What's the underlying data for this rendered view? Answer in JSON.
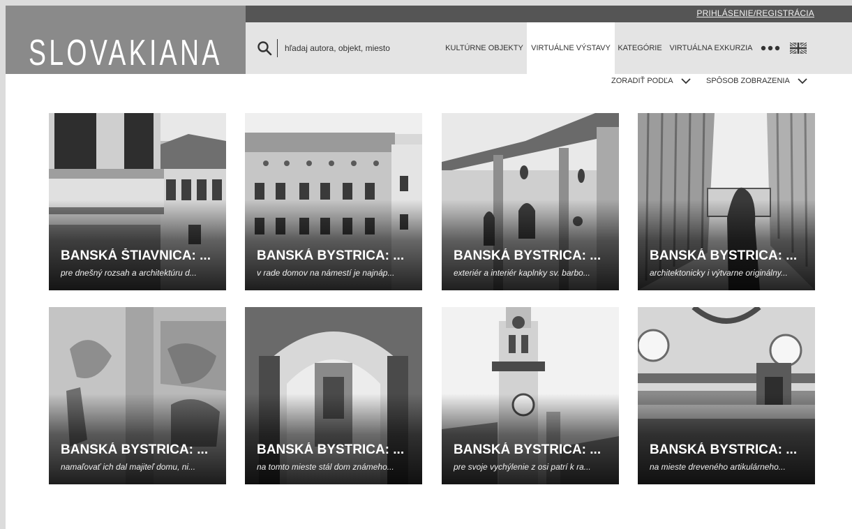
{
  "brand": {
    "logo": "SLOVAKIANA"
  },
  "header": {
    "login_label": "PRIHLÁSENIE/REGISTRÁCIA"
  },
  "search": {
    "placeholder": "hľadaj autora, objekt, miesto"
  },
  "nav": {
    "items": [
      {
        "label": "KULTÚRNE OBJEKTY",
        "active": false
      },
      {
        "label": "VIRTUÁLNE VÝSTAVY",
        "active": true
      },
      {
        "label": "KATEGÓRIE",
        "active": false
      },
      {
        "label": "VIRTUÁLNA EXKURZIA",
        "active": false
      }
    ],
    "more_icon": "ellipsis-icon",
    "language_icon": "uk-flag-icon"
  },
  "toolbar": {
    "sort_label": "ZORADIŤ PODĽA",
    "view_label": "SPÔSOB ZOBRAZENIA"
  },
  "exhibitions": [
    {
      "title": "BANSKÁ ŠTIAVNICA: ...",
      "subtitle": "pre dnešný rozsah a architektúru d..."
    },
    {
      "title": "BANSKÁ BYSTRICA: ...",
      "subtitle": "v rade domov na námestí je najnáp..."
    },
    {
      "title": "BANSKÁ BYSTRICA: ...",
      "subtitle": "exteriér a interiér kaplnky sv. barbo..."
    },
    {
      "title": "BANSKÁ BYSTRICA: ...",
      "subtitle": "architektonicky i výtvarne originálny..."
    },
    {
      "title": "BANSKÁ BYSTRICA: ...",
      "subtitle": "namaľovať ich dal majiteľ domu, ni..."
    },
    {
      "title": "BANSKÁ BYSTRICA: ...",
      "subtitle": "na tomto mieste stál dom známeho..."
    },
    {
      "title": "BANSKÁ BYSTRICA: ...",
      "subtitle": "pre svoje vychýlenie z osi patrí k ra..."
    },
    {
      "title": "BANSKÁ BYSTRICA: ...",
      "subtitle": "na mieste dreveného artikulárneho..."
    }
  ]
}
